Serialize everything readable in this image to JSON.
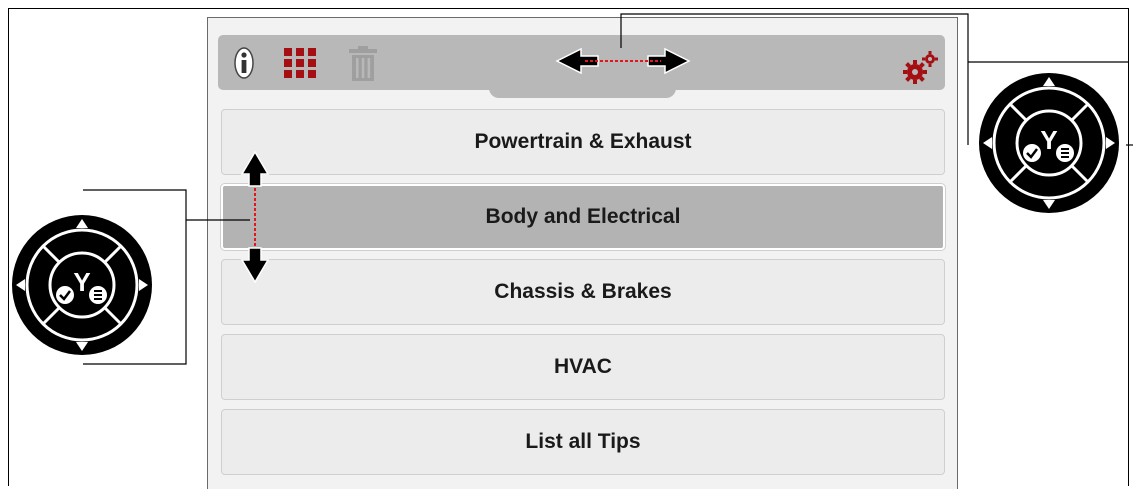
{
  "toolbar": {
    "icons": [
      "info-icon",
      "grid-icon",
      "trash-icon",
      "horizontal-arrow-icon",
      "settings-gears-icon"
    ],
    "accent_color": "#a50e12"
  },
  "menu": {
    "items": [
      {
        "label": "Powertrain & Exhaust",
        "selected": false
      },
      {
        "label": "Body and Electrical",
        "selected": true
      },
      {
        "label": "Chassis & Brakes",
        "selected": false
      },
      {
        "label": "HVAC",
        "selected": false
      },
      {
        "label": "List all Tips",
        "selected": false
      }
    ]
  },
  "controller": {
    "center_label": "Y",
    "icons": [
      "dpad-up-icon",
      "dpad-down-icon",
      "dpad-left-icon",
      "dpad-right-icon",
      "check-icon",
      "menu-icon"
    ]
  }
}
